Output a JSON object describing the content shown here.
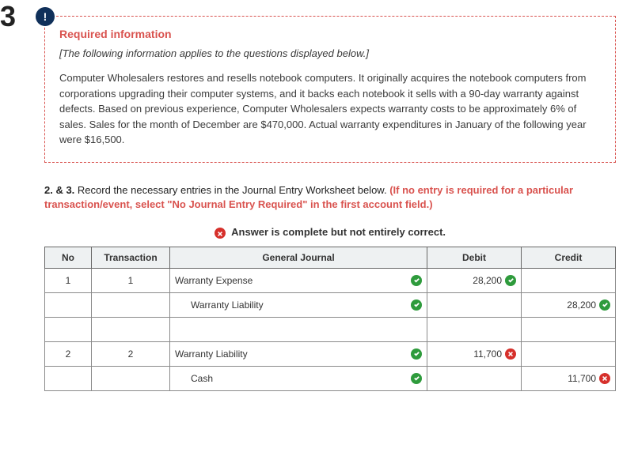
{
  "margin": {
    "big": "3",
    "small": "3"
  },
  "alert": {
    "badge": "!",
    "title": "Required information",
    "intro": "[The following information applies to the questions displayed below.]",
    "body": "Computer Wholesalers restores and resells notebook computers. It originally acquires the notebook computers from corporations upgrading their computer systems, and it backs each notebook it sells with a 90-day warranty against defects. Based on previous experience, Computer Wholesalers expects warranty costs to be approximately 6% of sales. Sales for the month of December are $470,000. Actual warranty expenditures in January of the following year were $16,500."
  },
  "instr": {
    "lead": "2. & 3.",
    "body": " Record the necessary entries in the Journal Entry Worksheet below. ",
    "red": "(If no entry is required for a particular transaction/event, select \"No Journal Entry Required\" in the first account field.)"
  },
  "banner": "Answer is complete but not entirely correct.",
  "headers": {
    "no": "No",
    "trans": "Transaction",
    "gj": "General Journal",
    "debit": "Debit",
    "credit": "Credit"
  },
  "rows": {
    "r1": {
      "no": "1",
      "trans": "1",
      "acct": "Warranty Expense",
      "debit": "28,200"
    },
    "r2": {
      "acct": "Warranty Liability",
      "credit": "28,200"
    },
    "r3": {
      "no": "2",
      "trans": "2",
      "acct": "Warranty Liability",
      "debit": "11,700"
    },
    "r4": {
      "acct": "Cash",
      "credit": "11,700"
    }
  }
}
